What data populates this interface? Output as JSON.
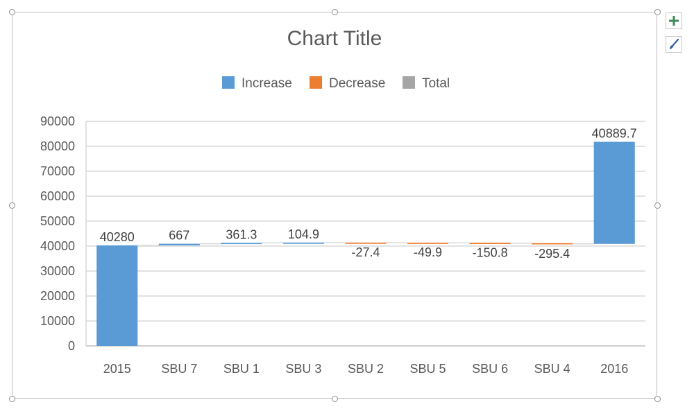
{
  "chart_data": {
    "type": "waterfall",
    "title": "Chart Title",
    "categories": [
      "2015",
      "SBU 7",
      "SBU 1",
      "SBU 3",
      "SBU 2",
      "SBU 5",
      "SBU 6",
      "SBU 4",
      "2016"
    ],
    "values": [
      40280,
      667,
      361.3,
      104.9,
      -27.4,
      -49.9,
      -150.8,
      -295.4,
      40889.7
    ],
    "labels": [
      "40280",
      "667",
      "361.3",
      "104.9",
      "-27.4",
      "-49.9",
      "-150.8",
      "-295.4",
      "40889.7"
    ],
    "kinds": [
      "increase",
      "increase",
      "increase",
      "increase",
      "decrease",
      "decrease",
      "decrease",
      "decrease",
      "increase"
    ],
    "legend": [
      {
        "name": "Increase",
        "color": "#5b9bd5"
      },
      {
        "name": "Decrease",
        "color": "#ed7d31"
      },
      {
        "name": "Total",
        "color": "#a5a5a5"
      }
    ],
    "legend_position": "top",
    "ylim": [
      0,
      90000
    ],
    "yticks": [
      "0",
      "10000",
      "20000",
      "30000",
      "40000",
      "50000",
      "60000",
      "70000",
      "80000",
      "90000"
    ],
    "grid": true,
    "xlabel": "",
    "ylabel": ""
  },
  "side_buttons": {
    "add_element": "chart-elements-plus-icon",
    "styles": "chart-styles-brush-icon"
  }
}
